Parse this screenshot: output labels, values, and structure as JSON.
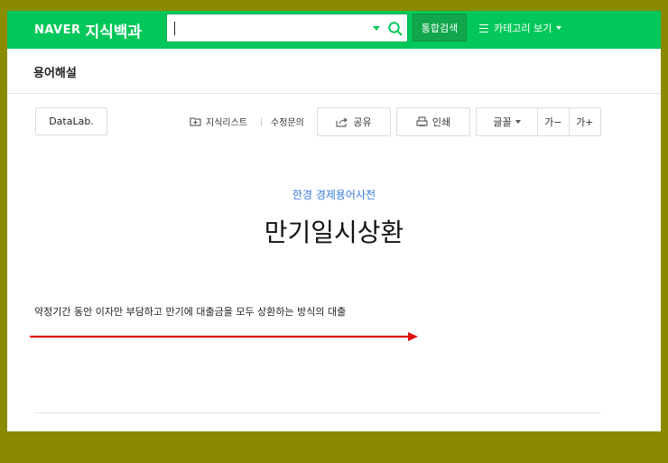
{
  "header": {
    "logo_brand": "NAVER",
    "logo_service": "지식백과",
    "search_value": "",
    "search_button": "통합검색",
    "category_label": "카테고리 보기"
  },
  "subheader": {
    "title": "용어해설"
  },
  "toolbar": {
    "datalab": "DataLab.",
    "knowledge_list": "지식리스트",
    "edit_request": "수정문의",
    "share": "공유",
    "print": "인쇄",
    "font": "글꼴",
    "font_smaller": "가−",
    "font_larger": "가+"
  },
  "article": {
    "source": "한경 경제용어사전",
    "term": "만기일시상환",
    "description": "약정기간 동안 이자만 부담하고 만기에 대출금을 모두 상환하는 방식의 대출"
  },
  "colors": {
    "brand_green": "#03c75a",
    "source_link": "#3a7be0",
    "annotation_arrow": "#e01010",
    "background": "#8a8a00"
  }
}
